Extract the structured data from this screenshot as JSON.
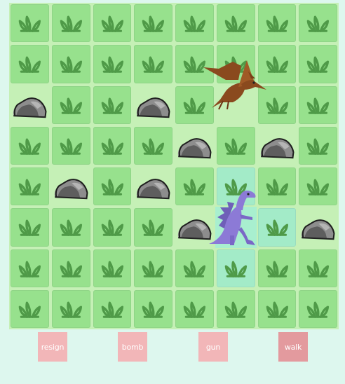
{
  "grid": {
    "rows": 8,
    "cols": 8,
    "cells": [
      [
        "grass",
        "grass",
        "grass",
        "grass",
        "grass",
        "grass",
        "grass",
        "grass"
      ],
      [
        "grass",
        "grass",
        "grass",
        "grass",
        "grass",
        "grass",
        "grass",
        "grass"
      ],
      [
        "rock",
        "grass",
        "grass",
        "rock",
        "grass",
        "empty",
        "grass",
        "grass"
      ],
      [
        "grass",
        "grass",
        "grass",
        "grass",
        "rock",
        "grass",
        "rock",
        "grass"
      ],
      [
        "grass",
        "rock",
        "grass",
        "rock",
        "grass",
        "grass-hl",
        "grass",
        "grass"
      ],
      [
        "grass",
        "grass",
        "grass",
        "grass",
        "rock",
        "empty-hl",
        "grass-hl",
        "rock"
      ],
      [
        "grass",
        "grass",
        "grass",
        "grass",
        "grass",
        "grass-hl",
        "grass",
        "grass"
      ],
      [
        "grass",
        "grass",
        "grass",
        "grass",
        "grass",
        "grass",
        "grass",
        "grass"
      ]
    ]
  },
  "sprites": {
    "pterodactyl": {
      "icon": "pterodactyl-icon",
      "color": "#8a4a1e",
      "row": 1,
      "col": 5
    },
    "dinosaur": {
      "icon": "dinosaur-icon",
      "color": "#8c7ad6",
      "row": 5,
      "col": 5
    }
  },
  "colors": {
    "board": "#c5f0b6",
    "grass_tile": "#97e18d",
    "grass_icon": "#4f9a48",
    "highlight": "#a8efcf",
    "button": "#f2b6b8",
    "button_active": "#e39a9e"
  },
  "actions": [
    {
      "label": "resign",
      "active": false
    },
    {
      "label": "bomb",
      "active": false
    },
    {
      "label": "gun",
      "active": false
    },
    {
      "label": "walk",
      "active": true
    }
  ]
}
